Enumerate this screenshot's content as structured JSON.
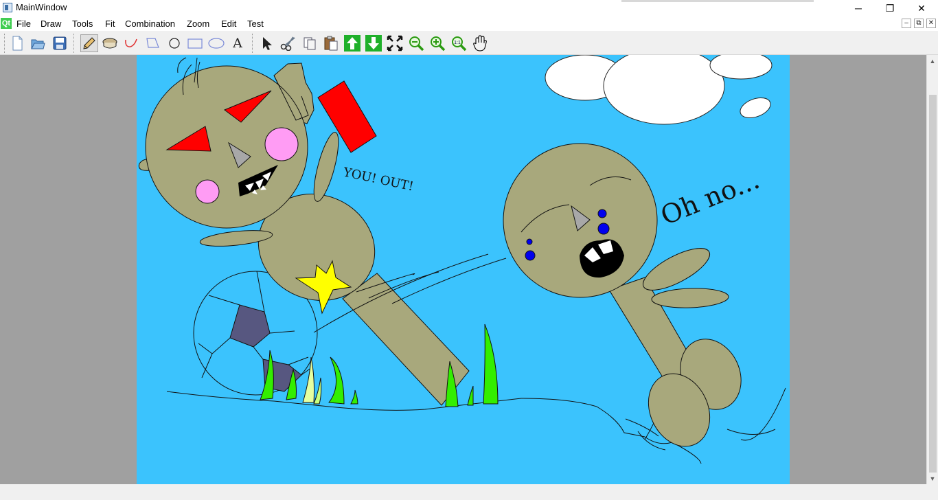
{
  "window": {
    "title": "MainWindow",
    "controls": {
      "minimize": "─",
      "maximize": "❐",
      "close": "✕"
    }
  },
  "menubar": {
    "logo": "Qt",
    "items": [
      {
        "label": "File"
      },
      {
        "label": "Draw"
      },
      {
        "label": "Tools"
      },
      {
        "label": "Fit"
      },
      {
        "label": "Combination"
      },
      {
        "label": "Zoom"
      },
      {
        "label": "Edit"
      },
      {
        "label": "Test"
      }
    ],
    "mdi_controls": {
      "minimize": "–",
      "restore": "⧉",
      "close": "✕"
    }
  },
  "toolbar": {
    "tools": [
      {
        "name": "new-file-icon"
      },
      {
        "name": "open-file-icon"
      },
      {
        "name": "save-icon"
      },
      {
        "name": "pencil-icon",
        "active": true
      },
      {
        "name": "fill-bucket-icon"
      },
      {
        "name": "curve-icon"
      },
      {
        "name": "polygon-icon"
      },
      {
        "name": "circle-icon"
      },
      {
        "name": "rectangle-icon"
      },
      {
        "name": "ellipse-icon"
      },
      {
        "name": "text-tool-icon",
        "glyph": "A"
      },
      {
        "name": "select-arrow-icon"
      },
      {
        "name": "scissors-icon"
      },
      {
        "name": "copy-icon"
      },
      {
        "name": "paste-icon"
      },
      {
        "name": "move-up-icon"
      },
      {
        "name": "move-down-icon"
      },
      {
        "name": "fit-screen-icon"
      },
      {
        "name": "zoom-out-icon"
      },
      {
        "name": "zoom-in-icon"
      },
      {
        "name": "zoom-actual-size-icon",
        "glyph": "1:1"
      },
      {
        "name": "hand-pan-icon"
      }
    ]
  },
  "canvas": {
    "background": "#3bc3fd",
    "texts": {
      "left_shout": "YOU! OUT!",
      "right_shout": "Oh no..."
    }
  },
  "colors": {
    "skin": "#a8a87c",
    "sky": "#3bc3fd",
    "red": "#ff0000",
    "pink": "#ff9cf4",
    "grass": "#33ee00",
    "star": "#ffff00",
    "ball_patch": "#575780",
    "eye_blue": "#0000ee"
  }
}
